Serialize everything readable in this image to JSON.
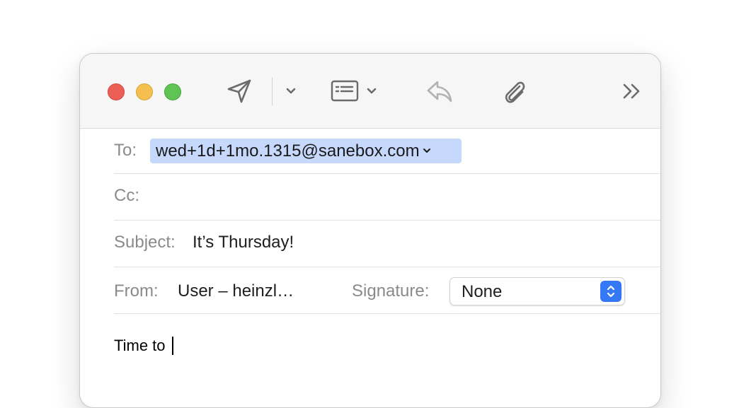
{
  "toolbar": {
    "icons": [
      "close-icon",
      "minimize-icon",
      "zoom-icon",
      "send-icon",
      "chevron-down-icon",
      "header-fields-icon",
      "chevron-down-icon",
      "reply-icon",
      "attachment-icon",
      "more-toolbar-icon"
    ],
    "traffic_light_colors": {
      "close": "#ec5f57",
      "minimize": "#f4bf4f",
      "zoom": "#5fc453"
    }
  },
  "fields": {
    "to_label": "To:",
    "to_recipient": "wed+1d+1mo.1315@sanebox.com",
    "cc_label": "Cc:",
    "subject_label": "Subject:",
    "subject_value": "It’s Thursday!",
    "from_label": "From:",
    "from_value": "User – heinzl…",
    "signature_label": "Signature:",
    "signature_value": "None"
  },
  "body": {
    "text": "Time to "
  },
  "colors": {
    "recipient_token": "#c6d8fb",
    "accent": "#3478f6"
  }
}
